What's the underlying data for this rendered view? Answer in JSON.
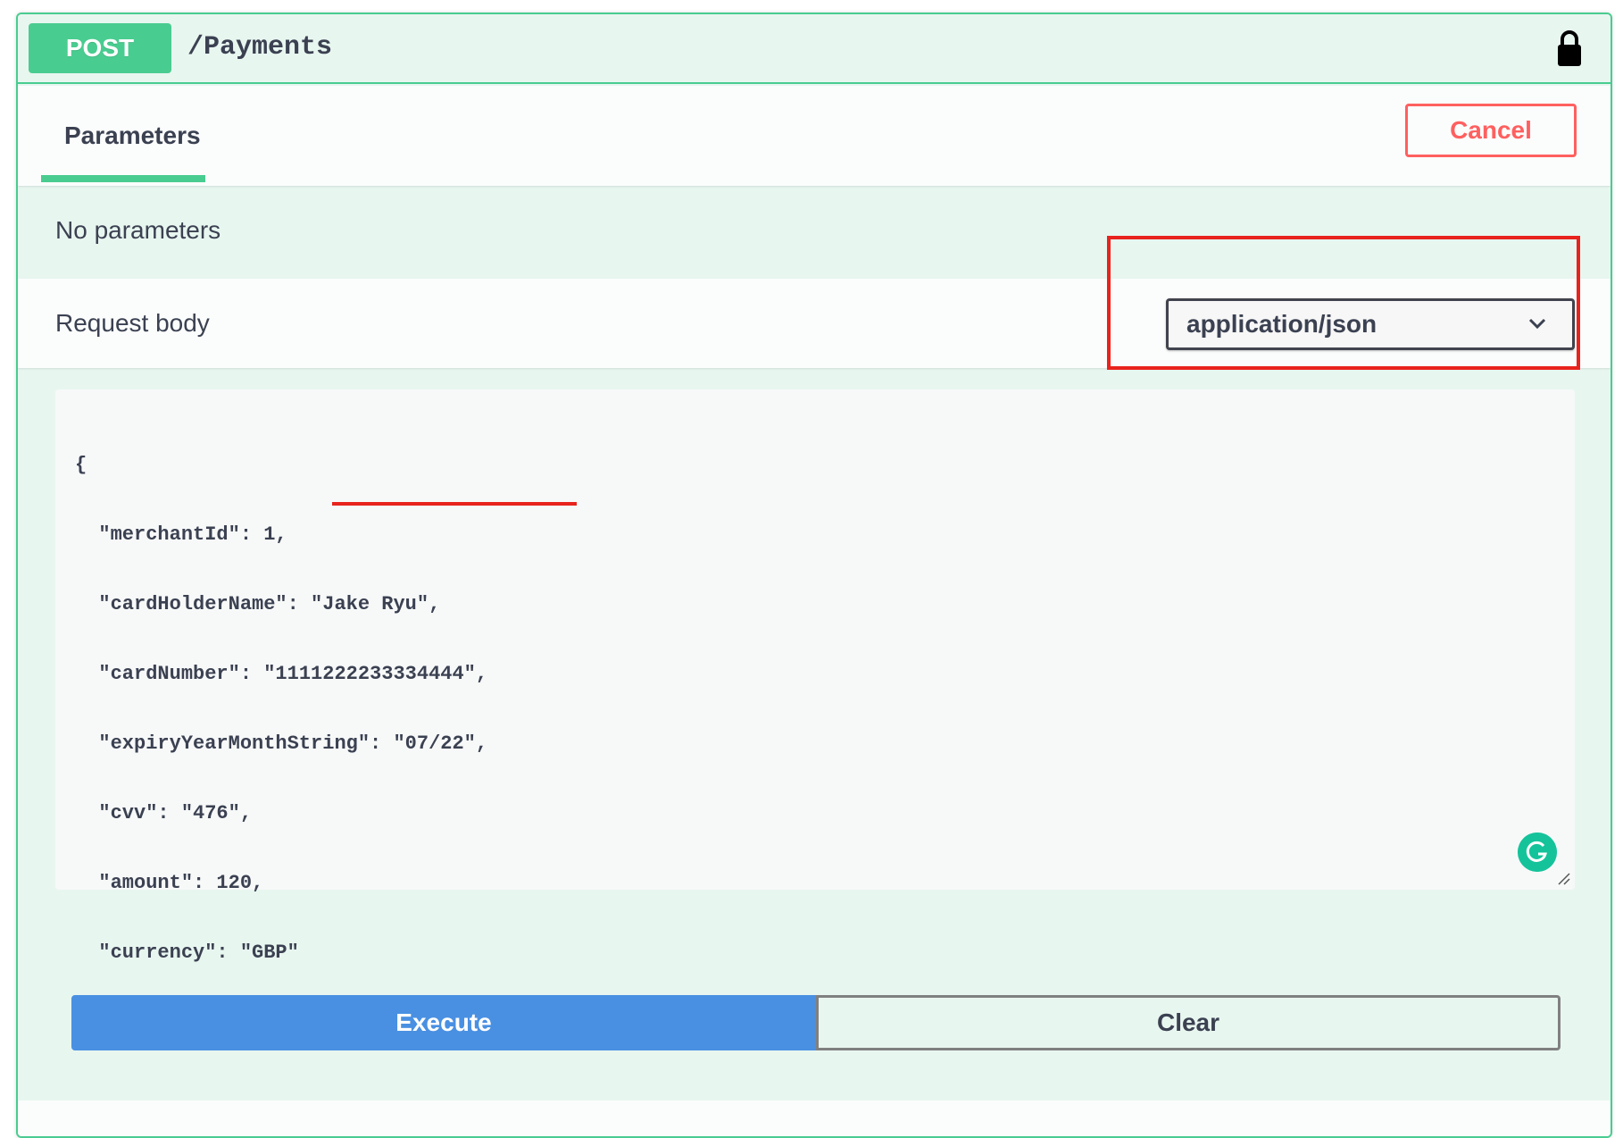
{
  "operation": {
    "method": "POST",
    "path": "/Payments"
  },
  "parameters": {
    "tab_label": "Parameters",
    "cancel_label": "Cancel",
    "empty_text": "No parameters"
  },
  "request_body": {
    "title": "Request body",
    "content_type": "application/json",
    "lines": [
      "{",
      "  \"merchantId\": 1,",
      "  \"cardHolderName\": \"Jake Ryu\",",
      "  \"cardNumber\": \"1111222233334444\",",
      "  \"expiryYearMonthString\": \"07/22\",",
      "  \"cvv\": \"476\",",
      "  \"amount\": 120,",
      "  \"currency\": \"GBP\"",
      "}"
    ]
  },
  "actions": {
    "execute_label": "Execute",
    "clear_label": "Clear"
  },
  "icons": {
    "lock": "lock-icon",
    "dropdown": "chevron-down-icon",
    "grammarly": "grammarly-icon",
    "resize": "resize-handle-icon"
  },
  "colors": {
    "post_green": "#49cc90",
    "block_bg": "#e8f6f0",
    "cancel_red": "#ff6060",
    "execute_blue": "#4990e2",
    "annotation_red": "#e8231d",
    "text": "#3b4151"
  }
}
